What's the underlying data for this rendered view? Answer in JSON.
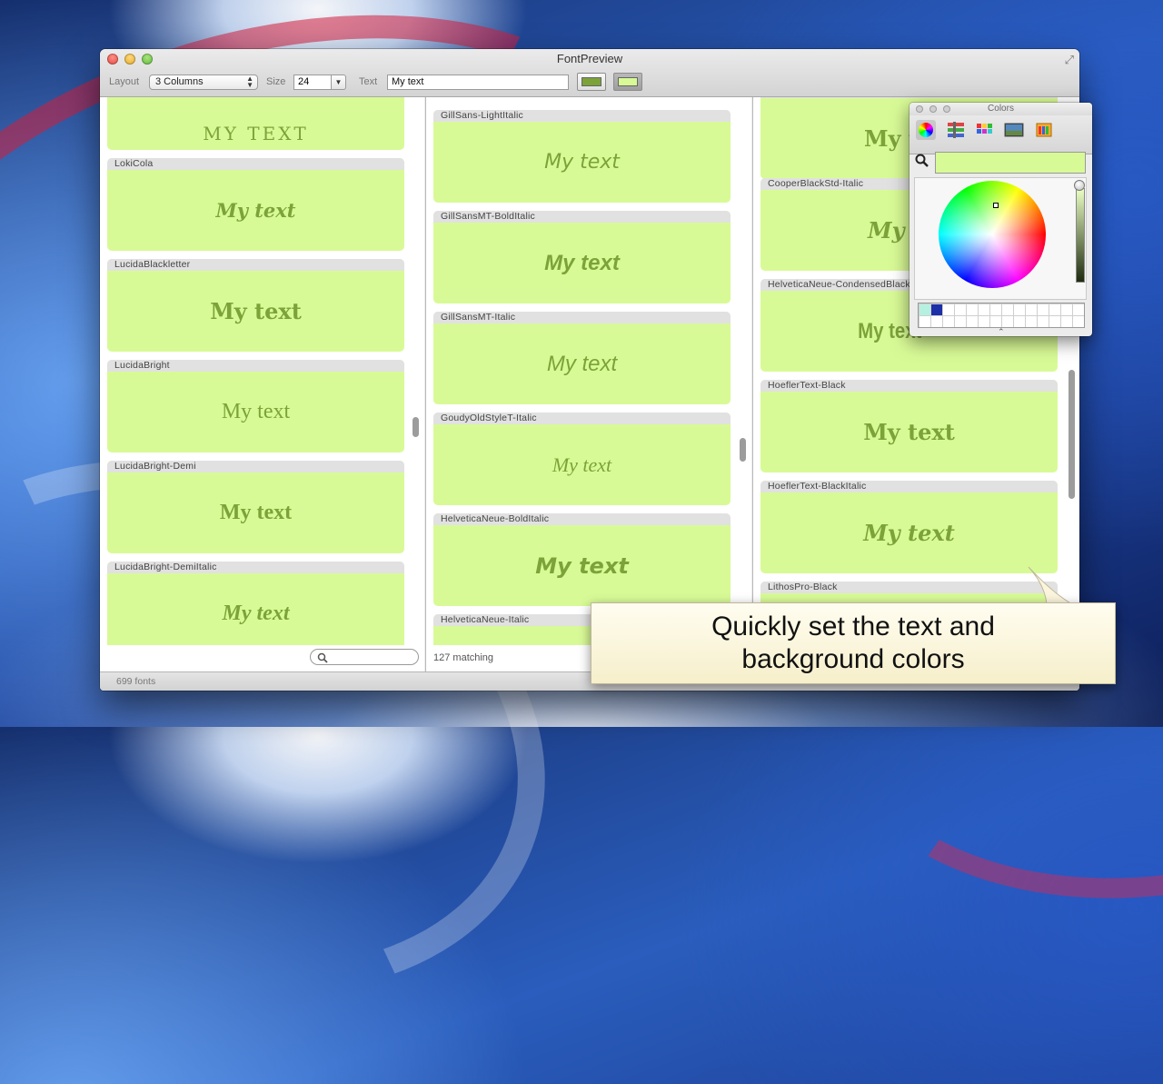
{
  "window": {
    "title": "FontPreview"
  },
  "toolbar": {
    "layout_label": "Layout",
    "layout_value": "3 Columns",
    "size_label": "Size",
    "size_value": "24",
    "text_label": "Text",
    "text_value": "My text",
    "text_color": "#7ca23a",
    "background_color": "#d8fa96"
  },
  "sample_text": "My text",
  "columns": [
    {
      "cards": [
        {
          "font": "",
          "sample": "MY TEXT"
        },
        {
          "font": "LokiCola",
          "sample": "My text"
        },
        {
          "font": "LucidaBlackletter",
          "sample": "My text"
        },
        {
          "font": "LucidaBright",
          "sample": "My text"
        },
        {
          "font": "LucidaBright-Demi",
          "sample": "My text"
        },
        {
          "font": "LucidaBright-DemiItalic",
          "sample": "My text"
        }
      ]
    },
    {
      "cards": [
        {
          "font": "GillSans-LightItalic",
          "sample": "My text"
        },
        {
          "font": "GillSansMT-BoldItalic",
          "sample": "My text"
        },
        {
          "font": "GillSansMT-Italic",
          "sample": "My text"
        },
        {
          "font": "GoudyOldStyleT-Italic",
          "sample": "My text"
        },
        {
          "font": "HelveticaNeue-BoldItalic",
          "sample": "My text"
        },
        {
          "font": "HelveticaNeue-Italic",
          "sample": ""
        }
      ],
      "footer": "127 matching"
    },
    {
      "cards": [
        {
          "font": "",
          "sample": "My text"
        },
        {
          "font": "CooperBlackStd-Italic",
          "sample": "My text"
        },
        {
          "font": "HelveticaNeue-CondensedBlack",
          "sample": "My text"
        },
        {
          "font": "HoeflerText-Black",
          "sample": "My text"
        },
        {
          "font": "HoeflerText-BlackItalic",
          "sample": "My text"
        },
        {
          "font": "LithosPro-Black",
          "sample": ""
        }
      ]
    }
  ],
  "status": {
    "font_count": "699 fonts"
  },
  "colors_panel": {
    "title": "Colors",
    "current_color": "#d8fa96",
    "tools": [
      "color-wheel-icon",
      "color-sliders-icon",
      "color-palettes-icon",
      "image-palettes-icon",
      "crayons-icon"
    ]
  },
  "callout": {
    "line1": "Quickly set the text and",
    "line2": "background colors"
  }
}
